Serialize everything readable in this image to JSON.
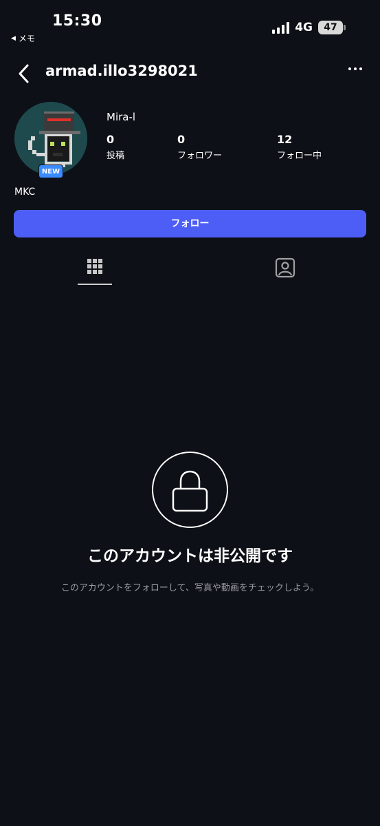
{
  "status_bar": {
    "time": "15:30",
    "back_app": "メモ",
    "network": "4G",
    "battery": "47"
  },
  "header": {
    "username": "armad.illo3298021"
  },
  "profile": {
    "display_name": "Mira-l",
    "badge": "NEW",
    "bio": "MKC",
    "stats": [
      {
        "value": "0",
        "label": "投稿"
      },
      {
        "value": "0",
        "label": "フォロワー"
      },
      {
        "value": "12",
        "label": "フォロー中"
      }
    ]
  },
  "actions": {
    "follow_label": "フォロー"
  },
  "tabs": [
    {
      "icon": "grid-icon",
      "active": true
    },
    {
      "icon": "tagged-icon",
      "active": false
    }
  ],
  "private_notice": {
    "title": "このアカウントは非公開です",
    "subtitle": "このアカウントをフォローして、写真や動画をチェックしよう。"
  },
  "colors": {
    "background": "#0d1016",
    "accent": "#4d5ef7",
    "badge": "#3a8bff",
    "muted_text": "#9a9ca3"
  }
}
